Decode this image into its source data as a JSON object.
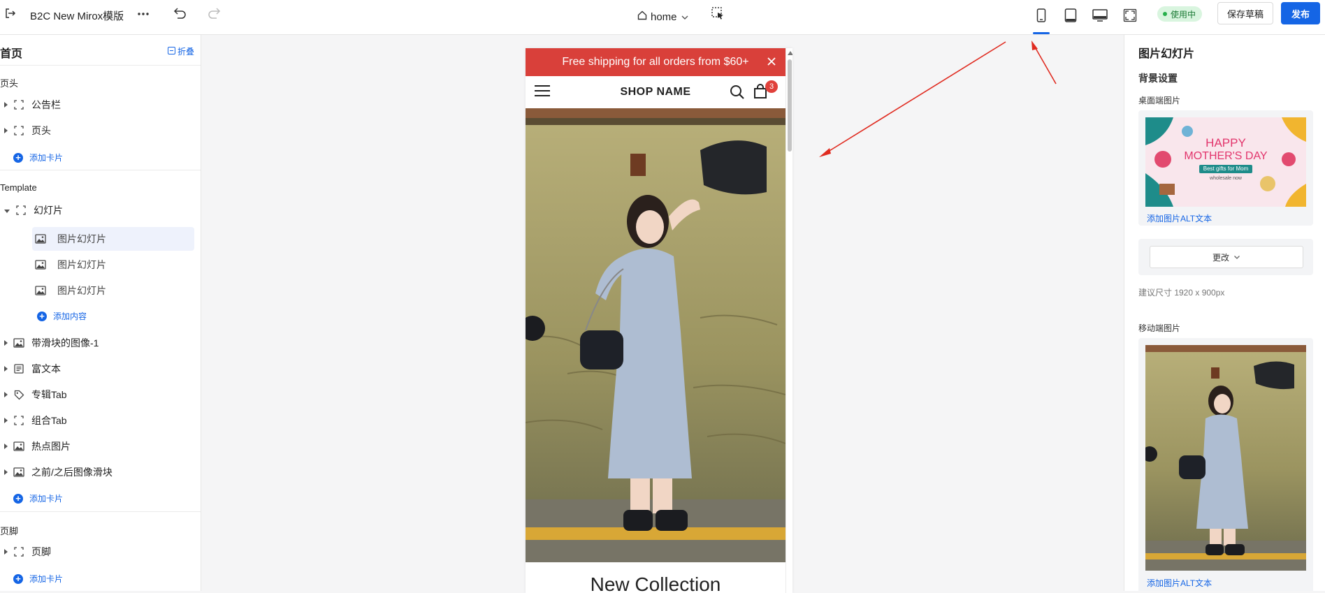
{
  "topbar": {
    "title": "B2C New Mirox模版",
    "page": "home",
    "status": "使用中",
    "save_draft": "保存草稿",
    "publish": "发布",
    "icons": [
      "exit-icon",
      "more-icon",
      "undo-icon",
      "redo-icon",
      "home-icon",
      "chevron-down-icon",
      "select-element-icon",
      "mobile-icon",
      "tablet-icon",
      "desktop-icon",
      "fullscreen-icon"
    ],
    "accent_color": "#1565e5",
    "active_device": "mobile"
  },
  "left_panel": {
    "title": "首页",
    "fold": "折叠",
    "header_section": {
      "label": "页头",
      "items": [
        {
          "label": "公告栏",
          "icon": "section-icon"
        },
        {
          "label": "页头",
          "icon": "section-icon"
        }
      ],
      "add": "添加卡片"
    },
    "template_section": {
      "label": "Template",
      "expanded_item": {
        "label": "幻灯片",
        "icon": "section-icon"
      },
      "children": [
        {
          "label": "图片幻灯片",
          "icon": "image-icon",
          "selected": true
        },
        {
          "label": "图片幻灯片",
          "icon": "image-icon",
          "selected": false
        },
        {
          "label": "图片幻灯片",
          "icon": "image-icon",
          "selected": false
        }
      ],
      "add_content": "添加内容",
      "items": [
        {
          "label": "带滑块的图像-1",
          "icon": "image-icon"
        },
        {
          "label": "富文本",
          "icon": "text-icon"
        },
        {
          "label": "专辑Tab",
          "icon": "tag-icon"
        },
        {
          "label": "组合Tab",
          "icon": "section-icon"
        },
        {
          "label": "热点图片",
          "icon": "image-icon"
        },
        {
          "label": "之前/之后图像滑块",
          "icon": "image-icon"
        }
      ],
      "add": "添加卡片"
    },
    "footer_section": {
      "label": "页脚",
      "items": [
        {
          "label": "页脚",
          "icon": "section-icon"
        }
      ],
      "add": "添加卡片"
    }
  },
  "preview": {
    "announcement": "Free shipping for all orders from $60+",
    "shop_name": "SHOP NAME",
    "cart_count": "3",
    "peek_title": "New Collection",
    "announcement_color": "#d9403a"
  },
  "right_panel": {
    "title": "图片幻灯片",
    "bg_settings": "背景设置",
    "desktop_image_label": "桌面端图片",
    "desktop_alt": "添加图片ALT文本",
    "banner_text_1": "HAPPY",
    "banner_text_2": "MOTHER'S DAY",
    "banner_text_3": "Best gifts for Mom",
    "banner_text_4": "wholesale now",
    "change": "更改",
    "size_hint": "建议尺寸 1920 x 900px",
    "mobile_image_label": "移动端图片",
    "mobile_alt": "添加图片ALT文本"
  }
}
